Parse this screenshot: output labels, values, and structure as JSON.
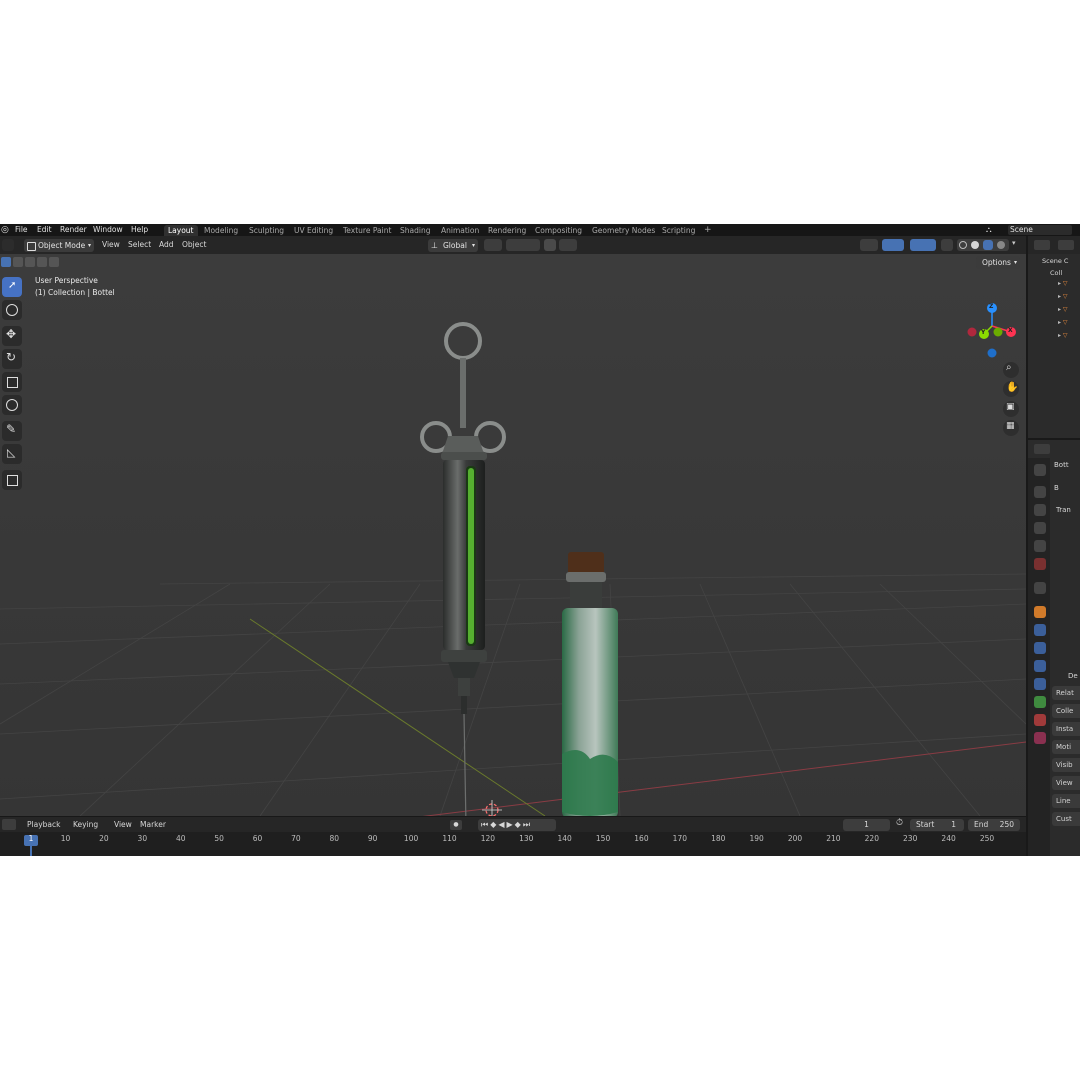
{
  "menu": [
    "File",
    "Edit",
    "Render",
    "Window",
    "Help"
  ],
  "workspaces": [
    "Layout",
    "Modeling",
    "Sculpting",
    "UV Editing",
    "Texture Paint",
    "Shading",
    "Animation",
    "Rendering",
    "Compositing",
    "Geometry Nodes",
    "Scripting",
    "+"
  ],
  "scene_name": "Scene",
  "header": {
    "mode": "Object Mode",
    "view": "View",
    "select": "Select",
    "add": "Add",
    "object": "Object",
    "orientation": "Global",
    "options": "Options"
  },
  "viewport": {
    "perspective": "User Perspective",
    "collection": "(1) Collection | Bottel",
    "gizmo": {
      "x": "X",
      "y": "Y",
      "z": "Z"
    }
  },
  "outliner": {
    "title": "Scene C",
    "collection": "Coll"
  },
  "properties": {
    "object_name": "Bott",
    "data_name": "B",
    "transform": "Tran",
    "delta": "De",
    "panels": [
      "Relat",
      "Colle",
      "Insta",
      "Moti",
      "Visib",
      "View",
      "Line",
      "Cust"
    ]
  },
  "timeline": {
    "playback": "Playback",
    "keying": "Keying",
    "view": "View",
    "marker": "Marker",
    "current_frame": "1",
    "start_label": "Start",
    "start": "1",
    "end_label": "End",
    "end": "250",
    "ticks": [
      "1",
      "10",
      "20",
      "30",
      "40",
      "50",
      "60",
      "70",
      "80",
      "90",
      "100",
      "110",
      "120",
      "130",
      "140",
      "150",
      "160",
      "170",
      "180",
      "190",
      "200",
      "210",
      "220",
      "230",
      "240",
      "250"
    ]
  },
  "colors": {
    "accent": "#4772b3",
    "axis_x": "#ff3352",
    "axis_y": "#8bdc00",
    "axis_z": "#2890ff",
    "viewport_bg": "#3b3b3b"
  }
}
